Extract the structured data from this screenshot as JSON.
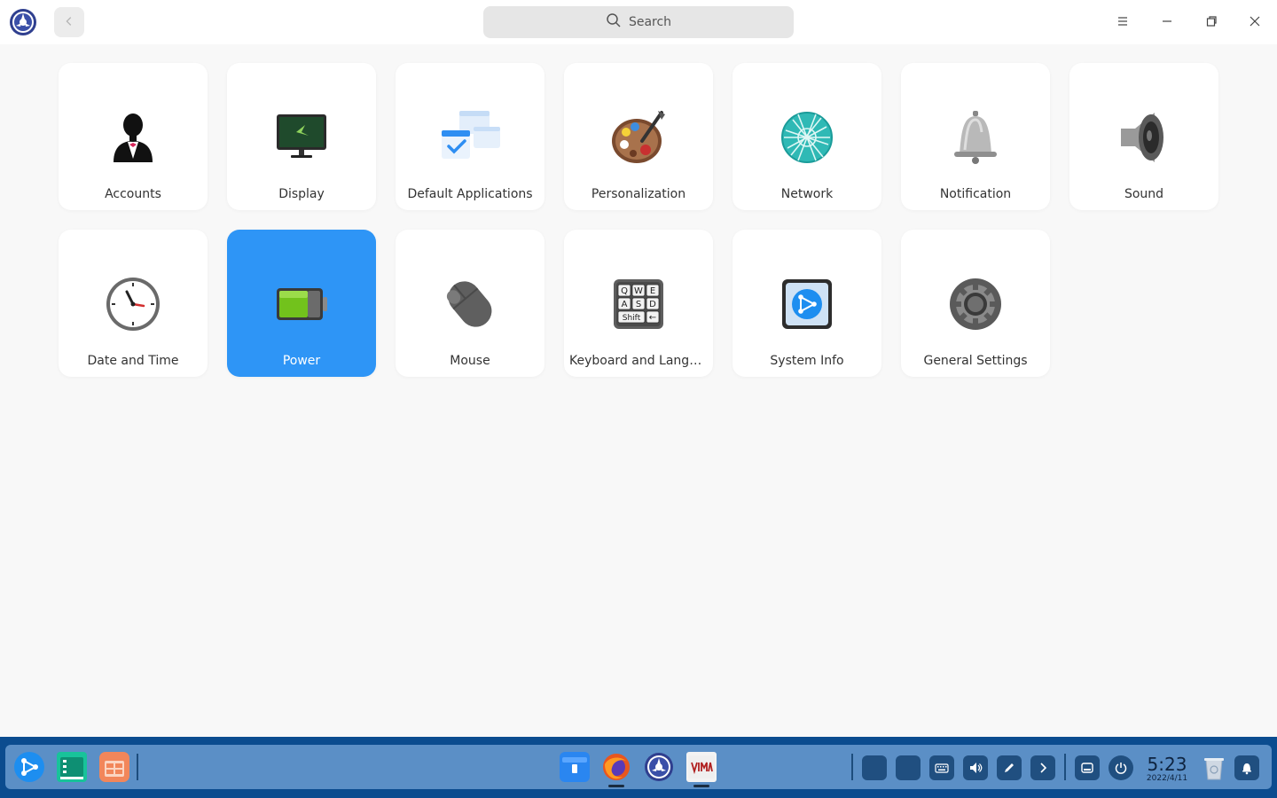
{
  "titlebar": {
    "search_placeholder": "Search",
    "back_icon": "chevron-left-icon",
    "menu_icon": "hamburger-menu-icon",
    "minimize_icon": "minimize-icon",
    "maximize_icon": "maximize-icon",
    "close_icon": "close-icon"
  },
  "modules": [
    {
      "label": "Accounts",
      "icon": "accounts-icon"
    },
    {
      "label": "Display",
      "icon": "display-icon"
    },
    {
      "label": "Default Applications",
      "icon": "default-applications-icon"
    },
    {
      "label": "Personalization",
      "icon": "personalization-icon"
    },
    {
      "label": "Network",
      "icon": "network-icon"
    },
    {
      "label": "Notification",
      "icon": "notification-bell-icon"
    },
    {
      "label": "Sound",
      "icon": "speaker-icon"
    },
    {
      "label": "Date and Time",
      "icon": "clock-icon"
    },
    {
      "label": "Power",
      "icon": "battery-icon",
      "selected": true
    },
    {
      "label": "Mouse",
      "icon": "mouse-icon"
    },
    {
      "label": "Keyboard and Langua...",
      "icon": "keyboard-icon"
    },
    {
      "label": "System Info",
      "icon": "system-info-icon"
    },
    {
      "label": "General Settings",
      "icon": "gear-icon"
    }
  ],
  "keyboard_keys": {
    "row1": "QWE",
    "row2": "ASD",
    "row3": "Shift"
  },
  "taskbar": {
    "time": "5:23",
    "date": "2022/4/11",
    "colors": {
      "bar": "#0b4c8f",
      "panel": "#5b8fc6",
      "selected_tile": "#2e95f6"
    }
  }
}
